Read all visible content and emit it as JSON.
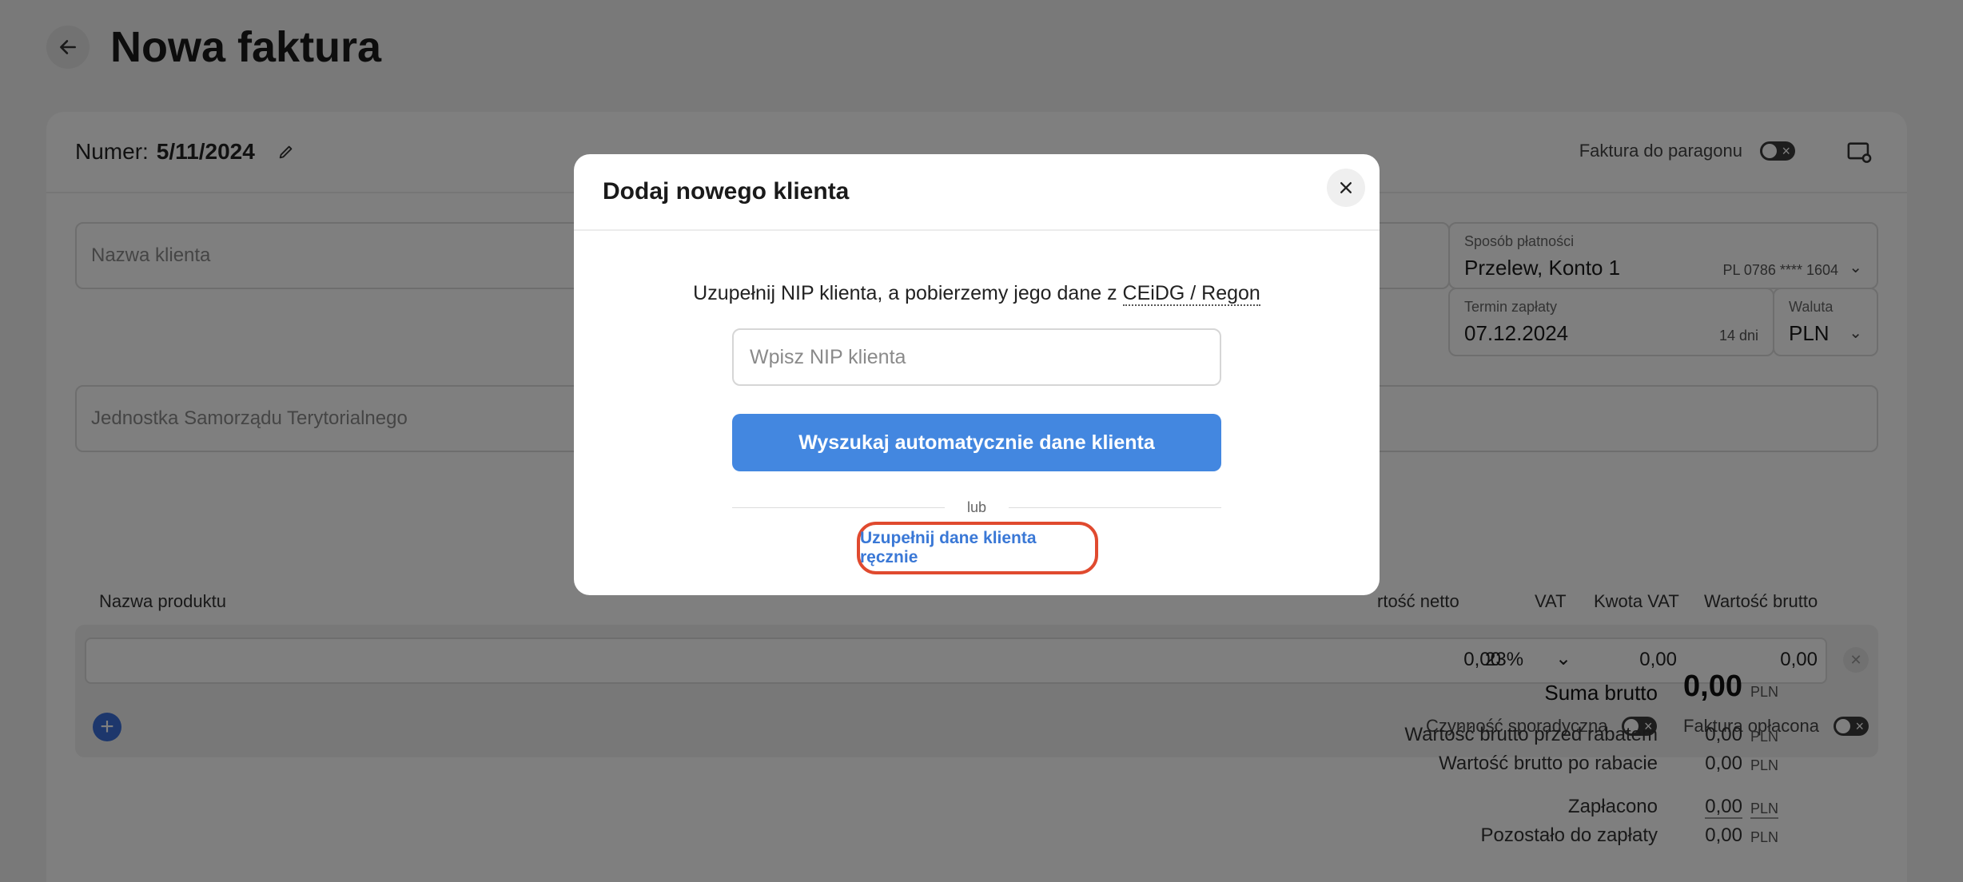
{
  "page": {
    "title": "Nowa faktura"
  },
  "invoice": {
    "number_label": "Numer:",
    "number_value": "5/11/2024",
    "receipt_toggle_label": "Faktura do paragonu"
  },
  "form": {
    "client_name_placeholder": "Nazwa klienta",
    "jst_placeholder": "Jednostka Samorządu Terytorialnego",
    "payment_method_label": "Sposób płatności",
    "payment_method_value": "Przelew, Konto 1",
    "payment_account": "PL 0786 **** 1604",
    "due_date_label": "Termin zapłaty",
    "due_date_value": "07.12.2024",
    "due_days": "14 dni",
    "currency_label": "Waluta",
    "currency_value": "PLN"
  },
  "products": {
    "headers": {
      "name": "Nazwa produktu",
      "net_value": "rtość netto",
      "vat": "VAT",
      "vat_amount": "Kwota VAT",
      "gross_value": "Wartość brutto"
    },
    "row": {
      "net": "0,00",
      "vat_rate": "23%",
      "vat_amount": "0,00",
      "gross": "0,00"
    },
    "occasional_label": "Czynność sporadyczna",
    "paid_label": "Faktura opłacona"
  },
  "summary": {
    "gross_sum_label": "Suma brutto",
    "gross_sum_value": "0,00",
    "before_discount_label": "Wartość brutto przed rabatem",
    "before_discount_value": "0,00",
    "after_discount_label": "Wartość brutto po rabacie",
    "after_discount_value": "0,00",
    "paid_label": "Zapłacono",
    "paid_value": "0,00",
    "remaining_label": "Pozostało do zapłaty",
    "remaining_value": "0,00",
    "currency": "PLN"
  },
  "modal": {
    "title": "Dodaj nowego klienta",
    "description": "Uzupełnij NIP klienta, a pobierzemy jego dane z",
    "source": "CEiDG / Regon",
    "nip_placeholder": "Wpisz NIP klienta",
    "search_button": "Wyszukaj automatycznie dane klienta",
    "or_label": "lub",
    "manual_link": "Uzupełnij dane klienta ręcznie"
  },
  "colors": {
    "primary": "#4387e0",
    "highlight": "#e04a2f",
    "link": "#3a78d6"
  }
}
